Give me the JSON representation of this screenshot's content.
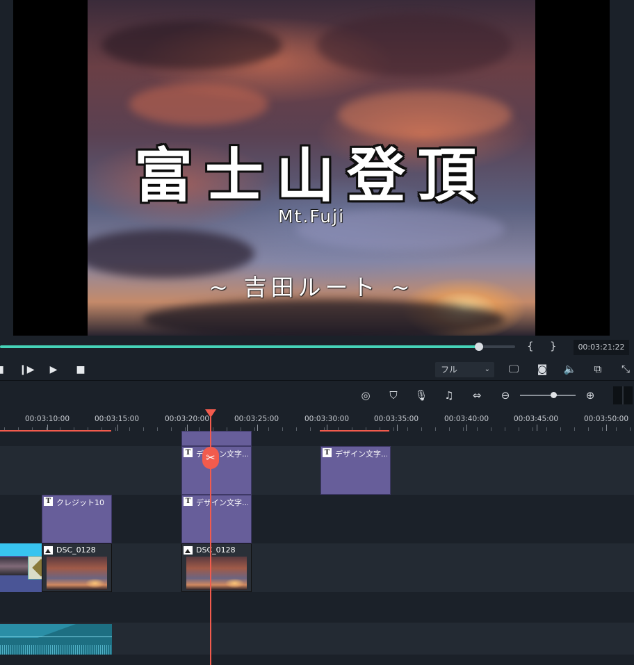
{
  "preview": {
    "title_main": "富士山登頂",
    "title_en": "Mt.Fuji",
    "title_sub": "~ 吉田ルート ~"
  },
  "scrubber": {
    "progress": 0.93,
    "bracket_in": "{",
    "bracket_out": "}",
    "timecode": "00:03:21:22"
  },
  "playback": {
    "quality": "フル",
    "icons": [
      "step-back-icon",
      "step-forward-icon",
      "play-icon",
      "stop-icon",
      "monitor-icon",
      "snapshot-icon",
      "volume-icon",
      "pip-icon",
      "fullscreen-icon"
    ]
  },
  "toolbar": {
    "icons": [
      "render-icon",
      "marker-icon",
      "voiceover-icon",
      "audio-mixer-icon",
      "fit-timeline-icon",
      "zoom-out-icon",
      "zoom-in-icon"
    ],
    "zoom_level": 0.6
  },
  "ruler": {
    "labels": [
      "00:03:10:00",
      "00:03:15:00",
      "00:03:20:00",
      "00:03:25:00",
      "00:03:30:00",
      "00:03:35:00",
      "00:03:40:00",
      "00:03:45:00",
      "00:03:50:00"
    ]
  },
  "tracks": {
    "clip_title_1": "デザイン文字...",
    "clip_title_2": "デザイン文字...",
    "clip_credit": "クレジット10",
    "clip_title_3": "デザイン文字...",
    "clip_img_1": "DSC_0128",
    "clip_img_2": "DSC_0128"
  },
  "colors": {
    "accent": "#46d3b8",
    "playhead": "#f25b4d",
    "title_clip": "#675e9a",
    "audio_clip": "#1d6f82"
  }
}
